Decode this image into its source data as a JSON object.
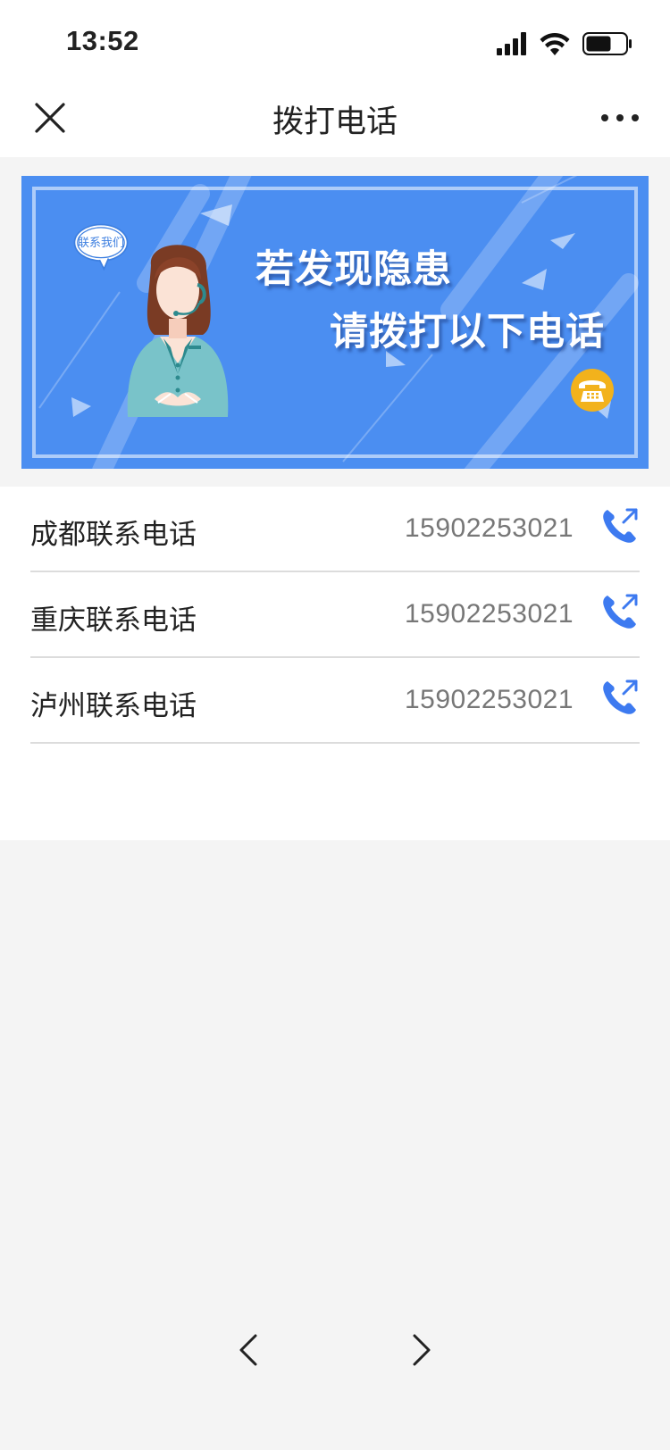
{
  "status_bar": {
    "time": "13:52",
    "icons": [
      "cellular-signal-icon",
      "wifi-icon",
      "battery-icon"
    ]
  },
  "nav": {
    "title": "拨打电话",
    "close_icon": "close-icon",
    "more_icon": "more-icon"
  },
  "banner": {
    "bubble_text": "联系我们",
    "line1": "若发现隐患",
    "line2": "请拨打以下电话",
    "background_color": "#4b8ef1",
    "badge_color": "#f2b21c",
    "illustration": "customer-service-agent-illustration",
    "badge_icon": "telephone-icon"
  },
  "contacts": [
    {
      "label": "成都联系电话",
      "number": "15902253021",
      "icon": "phone-call-icon"
    },
    {
      "label": "重庆联系电话",
      "number": "15902253021",
      "icon": "phone-call-icon"
    },
    {
      "label": "泸州联系电话",
      "number": "15902253021",
      "icon": "phone-call-icon"
    }
  ],
  "accent_color": "#3d7af0",
  "bottom_nav": {
    "back_icon": "chevron-left-icon",
    "forward_icon": "chevron-right-icon"
  }
}
